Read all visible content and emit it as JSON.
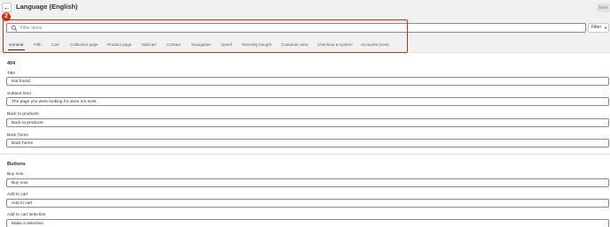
{
  "header": {
    "back_label": "←",
    "title": "Language (English)",
    "save_label": "Save"
  },
  "callout": {
    "number": "2"
  },
  "search": {
    "placeholder": "Filter items"
  },
  "filter": {
    "label": "Filter",
    "chevron": "▾"
  },
  "tabs": [
    {
      "label": "General",
      "active": true
    },
    {
      "label": "Filth",
      "active": false
    },
    {
      "label": "Cart",
      "active": false
    },
    {
      "label": "Collection page",
      "active": false
    },
    {
      "label": "Product page",
      "active": false
    },
    {
      "label": "Minicart",
      "active": false
    },
    {
      "label": "Contact",
      "active": false
    },
    {
      "label": "Navigation",
      "active": false
    },
    {
      "label": "Upsell",
      "active": false
    },
    {
      "label": "Recently bought",
      "active": false
    },
    {
      "label": "Customer area",
      "active": false
    },
    {
      "label": "Checkout & system",
      "active": false
    },
    {
      "label": "Accounts (new)",
      "active": false
    }
  ],
  "sections": {
    "s404": {
      "title": "404",
      "fields": [
        {
          "label": "Title",
          "value": "Not found"
        },
        {
          "label": "Subtext html",
          "value": "The page you were looking for does not exist"
        },
        {
          "label": "Back to products",
          "value": "Back to products"
        },
        {
          "label": "Back home",
          "value": "Back home"
        }
      ]
    },
    "buttons": {
      "title": "Buttons",
      "fields": [
        {
          "label": "Buy now",
          "value": "Buy now"
        },
        {
          "label": "Add to cart",
          "value": "Add to cart"
        },
        {
          "label": "Add to cart selection",
          "value": "Make a selection"
        }
      ]
    }
  },
  "colors": {
    "accent": "#d72c0d",
    "background": "#f1f1f1",
    "surface": "#ffffff"
  }
}
